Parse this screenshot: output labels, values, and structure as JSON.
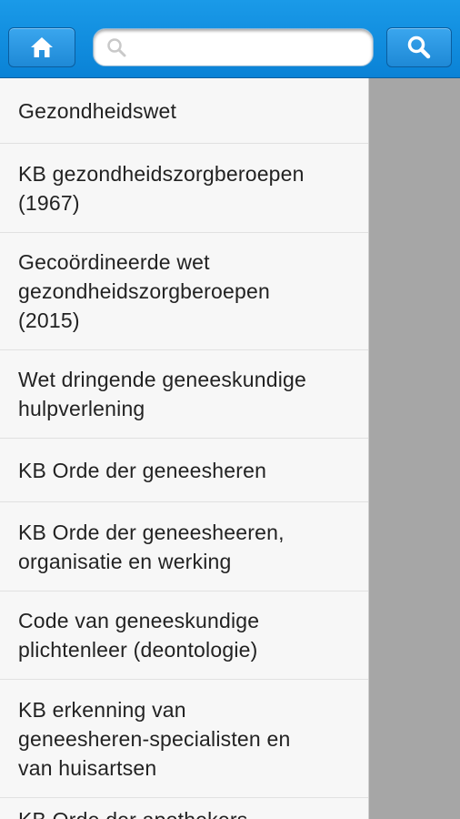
{
  "header": {
    "search": {
      "placeholder": "",
      "value": ""
    },
    "icons": {
      "home": "home-icon",
      "search_field": "search-icon",
      "search_button": "search-icon"
    }
  },
  "colors": {
    "header_bg": "#1a9ae8",
    "list_bg": "#f7f7f7",
    "overlay_bg": "#a6a6a6"
  },
  "menu": {
    "items": [
      {
        "label": "Gezondheidswet"
      },
      {
        "label": "KB gezondheidszorgberoepen\n(1967)"
      },
      {
        "label": "Gecoördineerde wet\ngezondheidszorgberoepen\n(2015)"
      },
      {
        "label": "Wet dringende geneeskundige\nhulpverlening"
      },
      {
        "label": "KB Orde der geneesheren"
      },
      {
        "label": "KB Orde der geneesheeren,\norganisatie en werking"
      },
      {
        "label": "Code van geneeskundige\nplichtenleer (deontologie)"
      },
      {
        "label": "KB erkenning van\ngeneesheren-specialisten en\nvan huisartsen"
      },
      {
        "label": "KB Orde der apothekers"
      }
    ]
  }
}
